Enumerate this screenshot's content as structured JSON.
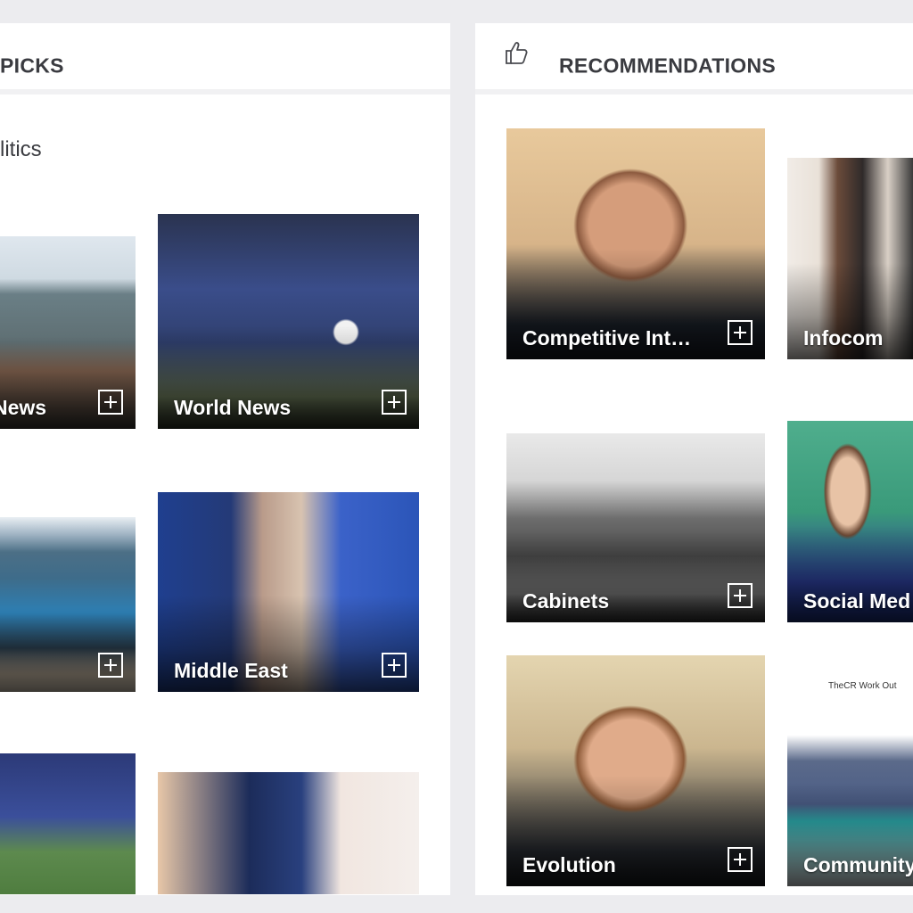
{
  "picks_panel": {
    "title": "PICKS",
    "section_title": "litics",
    "tiles": [
      {
        "label": "News",
        "icon": "plus-icon"
      },
      {
        "label": "World News",
        "icon": "plus-icon"
      },
      {
        "label": "",
        "icon": "plus-icon"
      },
      {
        "label": "Middle East",
        "icon": "plus-icon"
      },
      {
        "label": ""
      },
      {
        "label": ""
      }
    ]
  },
  "recommendations_panel": {
    "title": "RECOMMENDATIONS",
    "icon": "thumbs-up-icon",
    "tiles": [
      {
        "label": "Competitive Int…",
        "icon": "plus-icon"
      },
      {
        "label": "Infocom"
      },
      {
        "label": "Cabinets",
        "icon": "plus-icon"
      },
      {
        "label": "Social Med"
      },
      {
        "label": "Evolution",
        "icon": "plus-icon"
      },
      {
        "label": "Community",
        "caption": "TheCR Work Out"
      }
    ]
  }
}
